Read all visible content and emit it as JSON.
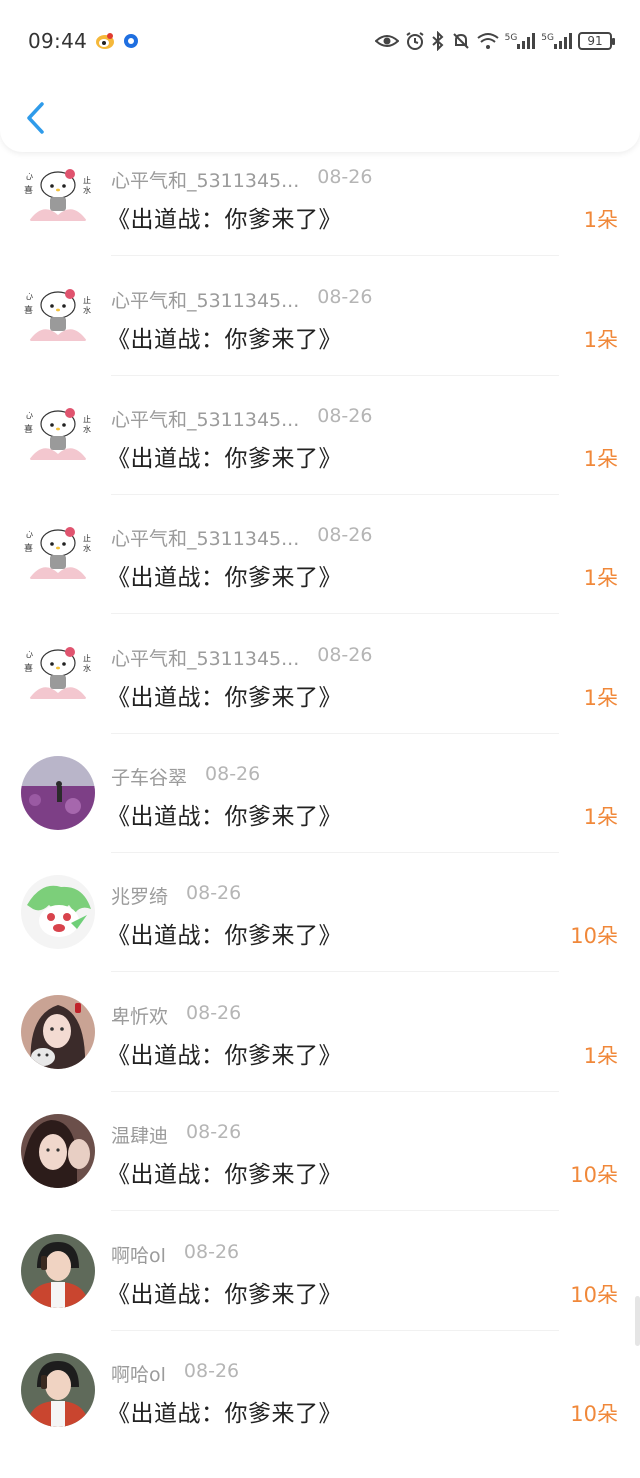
{
  "status_bar": {
    "time": "09:44",
    "battery": "91",
    "signal_5g_label": "5G"
  },
  "colors": {
    "accent_orange": "#f0883a",
    "back_blue": "#2f9bea",
    "muted_text": "#a3a3a3"
  },
  "list": {
    "items": [
      {
        "username": "心平气和_5311345...",
        "date": "08-26",
        "title": "《出道战：你爹来了》",
        "count": "1朵",
        "avatar_icon": "hello-kitty-avatar"
      },
      {
        "username": "心平气和_5311345...",
        "date": "08-26",
        "title": "《出道战：你爹来了》",
        "count": "1朵",
        "avatar_icon": "hello-kitty-avatar"
      },
      {
        "username": "心平气和_5311345...",
        "date": "08-26",
        "title": "《出道战：你爹来了》",
        "count": "1朵",
        "avatar_icon": "hello-kitty-avatar"
      },
      {
        "username": "心平气和_5311345...",
        "date": "08-26",
        "title": "《出道战：你爹来了》",
        "count": "1朵",
        "avatar_icon": "hello-kitty-avatar"
      },
      {
        "username": "心平气和_5311345...",
        "date": "08-26",
        "title": "《出道战：你爹来了》",
        "count": "1朵",
        "avatar_icon": "hello-kitty-avatar"
      },
      {
        "username": "子车谷翠",
        "date": "08-26",
        "title": "《出道战：你爹来了》",
        "count": "1朵",
        "avatar_icon": "purple-field-avatar"
      },
      {
        "username": "兆罗绮",
        "date": "08-26",
        "title": "《出道战：你爹来了》",
        "count": "10朵",
        "avatar_icon": "green-cartoon-avatar"
      },
      {
        "username": "卑忻欢",
        "date": "08-26",
        "title": "《出道战：你爹来了》",
        "count": "1朵",
        "avatar_icon": "girl-with-cat-avatar"
      },
      {
        "username": "温肆迪",
        "date": "08-26",
        "title": "《出道战：你爹来了》",
        "count": "10朵",
        "avatar_icon": "portrait-avatar"
      },
      {
        "username": "啊哈ol",
        "date": "08-26",
        "title": "《出道战：你爹来了》",
        "count": "10朵",
        "avatar_icon": "boy-jacket-avatar"
      },
      {
        "username": "啊哈ol",
        "date": "08-26",
        "title": "《出道战：你爹来了》",
        "count": "10朵",
        "avatar_icon": "boy-jacket-avatar"
      }
    ]
  }
}
